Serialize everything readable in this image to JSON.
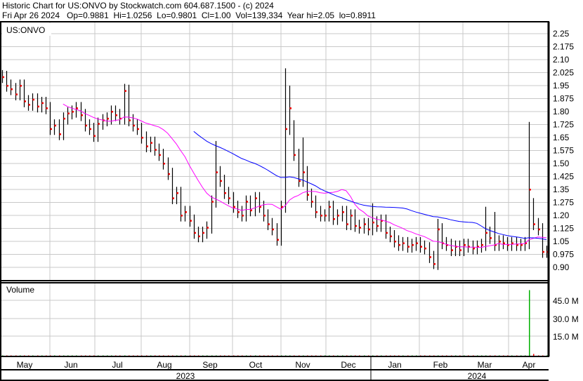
{
  "header": {
    "line1": "Historic Chart for US:ONVO by Stockwatch.com 604.687.1500 - (c) 2024",
    "line2": "Fri Apr 26 2024   Op=0.9881  Hi=1.0256  Lo=0.9801  Cl=1.00  Vol=139,334  Year hi=2.05  lo=0.8911"
  },
  "chart_data": {
    "type": "ohlc",
    "symbol": "US:ONVO",
    "price_axis": {
      "ylim": [
        0.86,
        2.3
      ],
      "ticks": [
        "2.25",
        "2.175",
        "2.10",
        "2.025",
        "1.95",
        "1.875",
        "1.80",
        "1.725",
        "1.65",
        "1.575",
        "1.50",
        "1.425",
        "1.35",
        "1.275",
        "1.20",
        "1.125",
        "1.05",
        "0.975",
        "0.90"
      ]
    },
    "closes": [
      2.0,
      1.95,
      1.93,
      1.9,
      1.95,
      1.86,
      1.84,
      1.87,
      1.83,
      1.85,
      1.82,
      1.7,
      1.72,
      1.67,
      1.76,
      1.79,
      1.8,
      1.82,
      1.78,
      1.72,
      1.7,
      1.66,
      1.73,
      1.75,
      1.76,
      1.8,
      1.78,
      1.76,
      1.92,
      1.75,
      1.72,
      1.7,
      1.65,
      1.6,
      1.62,
      1.58,
      1.55,
      1.5,
      1.44,
      1.3,
      1.33,
      1.2,
      1.22,
      1.17,
      1.1,
      1.08,
      1.1,
      1.13,
      1.28,
      1.45,
      1.4,
      1.33,
      1.3,
      1.25,
      1.22,
      1.2,
      1.28,
      1.23,
      1.3,
      1.25,
      1.2,
      1.15,
      1.12,
      1.06,
      1.25,
      1.7,
      1.82,
      1.55,
      1.4,
      1.45,
      1.32,
      1.28,
      1.22,
      1.2,
      1.2,
      1.25,
      1.18,
      1.2,
      1.22,
      1.15,
      1.2,
      1.14,
      1.13,
      1.15,
      1.12,
      1.16,
      1.14,
      1.17,
      1.1,
      1.08,
      1.05,
      1.03,
      1.04,
      1.02,
      1.03,
      1.04,
      1.02,
      1.01,
      0.96,
      0.92,
      1.12,
      1.04,
      1.03,
      1.0,
      1.02,
      1.0,
      1.03,
      1.02,
      1.01,
      1.02,
      1.03,
      1.1,
      1.07,
      1.03,
      1.05,
      1.04,
      1.03,
      1.04,
      1.03,
      1.03,
      1.04,
      1.35,
      1.15,
      1.12,
      0.99,
      0.99
    ],
    "high_overrides": {
      "0": 2.04,
      "28": 1.96,
      "49": 1.63,
      "65": 2.05,
      "66": 1.95,
      "67": 1.75,
      "69": 1.65,
      "85": 1.27,
      "100": 1.18,
      "111": 1.25,
      "113": 1.22,
      "121": 1.74,
      "122": 1.3
    },
    "low_overrides": {
      "99": 0.89
    },
    "moving_averages": [
      {
        "name": "short",
        "period": 15,
        "color": "#ff00ff"
      },
      {
        "name": "long",
        "period": 45,
        "color": "#0000ff"
      }
    ],
    "volume_axis": {
      "ylim": [
        0,
        60
      ],
      "unit": "M",
      "ticks": [
        "45.0 M",
        "30.0 M",
        "15.0 M"
      ]
    },
    "volume": {
      "baseline_millions": 0.3,
      "spikes": {
        "121": 55,
        "122": 1.5
      }
    },
    "volume_label": "Volume",
    "months": [
      "May",
      "Jun",
      "Jul",
      "Aug",
      "Sep",
      "Oct",
      "Nov",
      "Dec",
      "Jan",
      "Feb",
      "Mar",
      "Apr"
    ],
    "years": [
      "2023",
      "2024"
    ],
    "colors": {
      "bar": "#000000",
      "close_tick": "#ff0000",
      "grid": "#c8c8c8",
      "volume_up": "#00b000",
      "volume_down": "#ff0000"
    }
  }
}
